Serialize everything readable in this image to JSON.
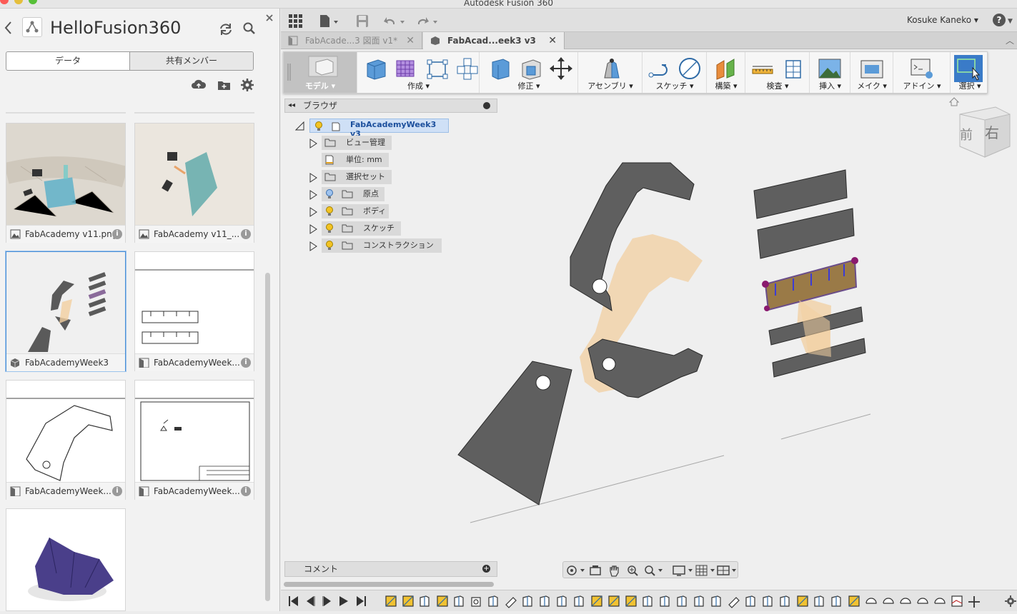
{
  "window": {
    "title": "Autodesk Fusion 360"
  },
  "left_panel": {
    "project_name": "HelloFusion360",
    "segments": [
      "データ",
      "共有メンバー"
    ],
    "files": [
      {
        "name": "FabAcademy v11.png",
        "type": "image"
      },
      {
        "name": "FabAcademy v11_...",
        "type": "image"
      },
      {
        "name": "FabAcademyWeek3",
        "type": "model",
        "selected": true
      },
      {
        "name": "FabAcademyWeek...",
        "type": "drawing"
      },
      {
        "name": "FabAcademyWeek...",
        "type": "drawing"
      },
      {
        "name": "FabAcademyWeek...",
        "type": "drawing"
      },
      {
        "name": "",
        "type": "model"
      }
    ]
  },
  "toolbar": {
    "user": "Kosuke Kaneko",
    "help": "?"
  },
  "tabs": [
    {
      "label": "FabAcade...3 図面 v1*",
      "active": false
    },
    {
      "label": "FabAcad...eek3 v3",
      "active": true
    }
  ],
  "ribbon": {
    "workspace": "モデル",
    "groups": [
      "作成",
      "修正",
      "アセンブリ",
      "スケッチ",
      "構築",
      "検査",
      "挿入",
      "メイク",
      "アドイン",
      "選択"
    ]
  },
  "browser": {
    "title": "ブラウザ",
    "root": "FabAcademyWeek3 v3",
    "nodes": [
      {
        "label": "ビュー管理",
        "bulb": false,
        "expand": true
      },
      {
        "label": "単位: mm",
        "bulb": false,
        "expand": false
      },
      {
        "label": "選択セット",
        "bulb": false,
        "expand": true
      },
      {
        "label": "原点",
        "bulb": "blue",
        "expand": true
      },
      {
        "label": "ボディ",
        "bulb": "yellow",
        "expand": true
      },
      {
        "label": "スケッチ",
        "bulb": "yellow",
        "expand": true
      },
      {
        "label": "コンストラクション",
        "bulb": "yellow",
        "expand": true
      }
    ]
  },
  "comment": {
    "label": "コメント"
  },
  "viewcube": {
    "front": "前",
    "right": "右"
  },
  "colors": {
    "body": "#5f5f5f",
    "ghost": "#f2cfa0",
    "selected": "#9a7a47",
    "accent": "#3a7bc8",
    "sketch": "#8a1a6e"
  }
}
